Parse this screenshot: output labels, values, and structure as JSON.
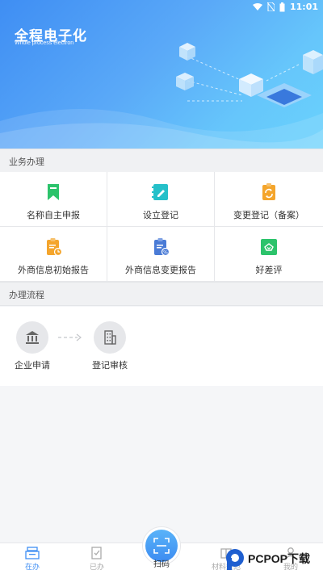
{
  "status_bar": {
    "time": "11:01"
  },
  "hero": {
    "title": "全程电子化",
    "subtitle": "Whole process electron"
  },
  "sections": {
    "business": "业务办理",
    "process": "办理流程"
  },
  "services": [
    {
      "label": "名称自主申报",
      "icon": "bookmark-icon",
      "color": "#2cc36b"
    },
    {
      "label": "设立登记",
      "icon": "edit-note-icon",
      "color": "#25c0c9"
    },
    {
      "label": "变更登记（备案）",
      "icon": "refresh-clipboard-icon",
      "color": "#f4a52c"
    },
    {
      "label": "外商信息初始报告",
      "icon": "report-clipboard-icon",
      "color": "#f4a52c"
    },
    {
      "label": "外商信息变更报告",
      "icon": "percent-clipboard-icon",
      "color": "#4a7bd6"
    },
    {
      "label": "好差评",
      "icon": "rating-icon",
      "color": "#2cc36b"
    }
  ],
  "flow": [
    {
      "label": "企业申请",
      "icon": "bank-icon"
    },
    {
      "label": "登记审核",
      "icon": "building-icon"
    }
  ],
  "tabs": [
    {
      "label": "在办",
      "icon": "in-progress-icon",
      "active": true
    },
    {
      "label": "已办",
      "icon": "done-icon",
      "active": false
    },
    {
      "label": "扫码",
      "icon": "scan-icon",
      "active": false
    },
    {
      "label": "材料规范",
      "icon": "materials-icon",
      "active": false
    },
    {
      "label": "我的",
      "icon": "profile-icon",
      "active": false
    }
  ],
  "watermark": {
    "text": "PCPOP下载"
  },
  "colors": {
    "accent": "#3f8ef3",
    "hero_start": "#3f8ef3",
    "hero_end": "#69d2fc"
  }
}
